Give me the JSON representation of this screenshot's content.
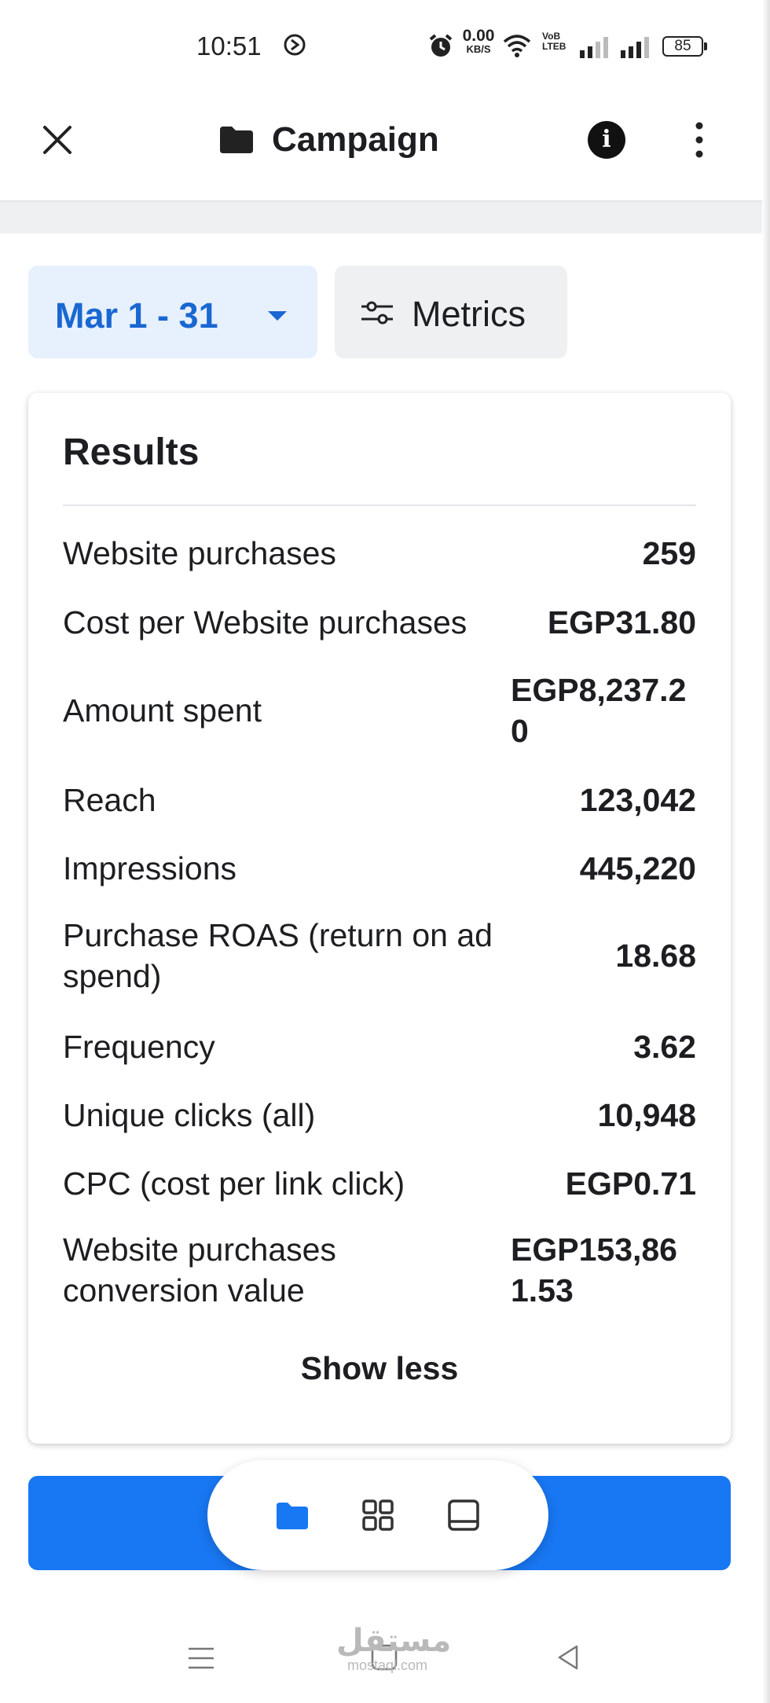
{
  "status_bar": {
    "time": "10:51",
    "net_speed": "0.00",
    "net_speed_unit": "KB/S",
    "volte_line1": "VoB",
    "volte_line2": "LTEB",
    "battery": "85",
    "icons": [
      "do-not-disturb-icon",
      "alarm-icon",
      "wifi-icon",
      "signal-icon",
      "battery-icon"
    ]
  },
  "header": {
    "title": "Campaign",
    "icons": [
      "close-icon",
      "folder-icon",
      "info-icon",
      "more-vertical-icon"
    ]
  },
  "filters": {
    "date_range": "Mar 1 - 31",
    "metrics_label": "Metrics",
    "accent_color": "#1967d2",
    "date_bg": "#e7f0fd"
  },
  "results": {
    "title": "Results",
    "rows": [
      {
        "label": "Website purchases",
        "value": "259"
      },
      {
        "label": "Cost per Website purchases",
        "value": "EGP31.80"
      },
      {
        "label": "Amount spent",
        "value": "EGP8,237.20"
      },
      {
        "label": "Reach",
        "value": "123,042"
      },
      {
        "label": "Impressions",
        "value": "445,220"
      },
      {
        "label": "Purchase ROAS (return on ad spend)",
        "value": "18.68"
      },
      {
        "label": "Frequency",
        "value": "3.62"
      },
      {
        "label": "Unique clicks (all)",
        "value": "10,948"
      },
      {
        "label": "CPC (cost per link click)",
        "value": "EGP0.71"
      },
      {
        "label": "Website purchases conversion value",
        "value": "EGP153,861.53"
      }
    ],
    "show_less": "Show less"
  },
  "bottom_bar": {
    "color": "#1877f2",
    "nav_icons": [
      "campaigns-folder-icon",
      "grid-icon",
      "ads-icon"
    ]
  },
  "system_nav": {
    "icons": [
      "menu-icon",
      "home-icon",
      "back-icon"
    ]
  },
  "watermark": {
    "arabic": "مستقل",
    "latin": "mostaql.com"
  }
}
